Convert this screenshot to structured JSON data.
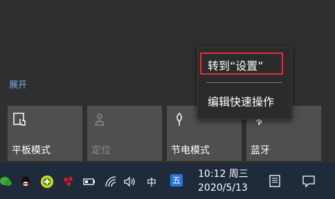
{
  "action_center": {
    "expand_label": "展开",
    "tiles": [
      {
        "label": "平板模式",
        "icon": "tablet-mode-icon",
        "enabled": true
      },
      {
        "label": "定位",
        "icon": "location-icon",
        "enabled": false
      },
      {
        "label": "节电模式",
        "icon": "battery-saver-icon",
        "enabled": true
      },
      {
        "label": "蓝牙",
        "icon": "bluetooth-icon",
        "enabled": true
      }
    ]
  },
  "context_menu": {
    "items": [
      {
        "label": "转到“设置”",
        "highlighted": true
      },
      {
        "label": "编辑快速操作",
        "highlighted": false
      }
    ],
    "highlight_color": "#e0303a"
  },
  "taskbar": {
    "tray_icons": [
      "wechat-icon",
      "qq-icon",
      "360-security-icon",
      "app-red-icon",
      "battery-icon",
      "wifi-icon",
      "volume-icon"
    ],
    "ime_lang": "中",
    "ime_mode": "五",
    "clock_time": "10:12 周三",
    "clock_date": "2020/5/13"
  },
  "colors": {
    "accent": "#76a8e0",
    "tile_bg": "#4f4f4f",
    "taskbar_bg": "#1f2a3a"
  }
}
